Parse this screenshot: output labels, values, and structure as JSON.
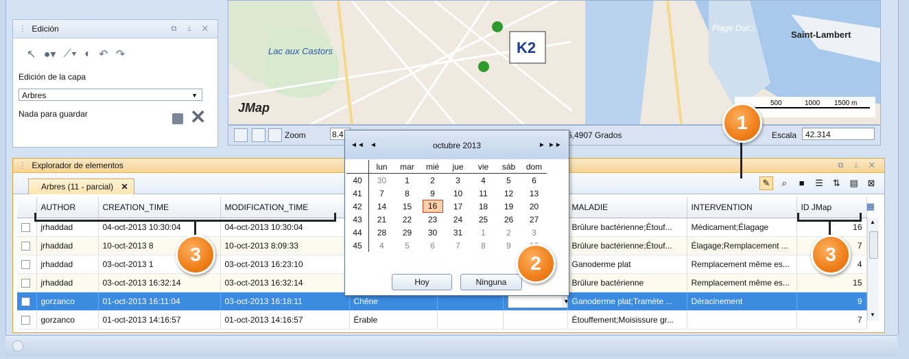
{
  "edition": {
    "title": "Edición",
    "layer_label": "Edición de la capa",
    "layer_value": "Arbres",
    "status": "Nada para guardar"
  },
  "map": {
    "labels": {
      "castors": "Lac aux Castors",
      "plage": "Plage Dor□",
      "lambert": "Saint-Lambert",
      "brand": "JMap",
      "logo": "K2"
    },
    "scalebar": [
      "500",
      "1000",
      "1500 m"
    ],
    "zoom_label": "Zoom",
    "zoom_value": "8.4",
    "coord_value": "5,4907 Grados",
    "scale_label": "Escala",
    "scale_value": "42.314"
  },
  "explorer": {
    "title": "Explorador de elementos",
    "tab_label": "Arbres (11 - parcial)",
    "tab_close": "✕",
    "columns": [
      "AUTHOR",
      "CREATION_TIME",
      "MODIFICATION_TIME",
      "",
      "",
      "",
      "MALADIE",
      "INTERVENTION",
      "ID JMap"
    ],
    "rows": [
      {
        "author": "jrhaddad",
        "created": "04-oct-2013 10:30:04",
        "modified": "04-oct-2013 10:30:04",
        "c4": "",
        "c5": "",
        "c6": "",
        "maladie": "Brûlure bactérienne;Étouf...",
        "intervention": "Médicament;Élagage",
        "id": "16"
      },
      {
        "author": "jrhaddad",
        "created": "10-oct-2013 8",
        "modified": "10-oct-2013 8:09:33",
        "c4": "",
        "c5": "",
        "c6": "",
        "maladie": "Brûlure bactérienne;Étouf...",
        "intervention": "Élagage;Remplacement ...",
        "id": "7"
      },
      {
        "author": "jrhaddad",
        "created": "03-oct-2013 1",
        "modified": "03-oct-2013 16:23:10",
        "c4": "",
        "c5": "",
        "c6": "",
        "maladie": "Ganoderme plat",
        "intervention": "Remplacement même es...",
        "id": "4"
      },
      {
        "author": "jrhaddad",
        "created": "03-oct-2013 16:32:14",
        "modified": "03-oct-2013 16:32:14",
        "c4": "",
        "c5": "",
        "c6": "",
        "maladie": "Brûlure bactérienne",
        "intervention": "Remplacement même es...",
        "id": "15"
      },
      {
        "author": "gorzanco",
        "created": "01-oct-2013 16:11:04",
        "modified": "03-oct-2013 16:18:11",
        "c4": "Chêne",
        "c5": "",
        "c6": "",
        "maladie": "Ganoderme plat;Tramète ...",
        "intervention": "Déracinement",
        "id": "9"
      },
      {
        "author": "gorzanco",
        "created": "01-oct-2013 14:16:57",
        "modified": "01-oct-2013 14:16:57",
        "c4": "Érable",
        "c5": "",
        "c6": "",
        "maladie": "Étouffement;Moisissure gr...",
        "intervention": "",
        "id": "7"
      }
    ]
  },
  "calendar": {
    "title": "octubre 2013",
    "nav_prev_year": "◄◄",
    "nav_prev": "◄",
    "nav_next": "►",
    "nav_next_year": "►►",
    "weekdays": [
      "lun",
      "mar",
      "mié",
      "jue",
      "vie",
      "sáb",
      "dom"
    ],
    "weeks": [
      {
        "wk": "40",
        "days": [
          "30",
          "1",
          "2",
          "3",
          "4",
          "5",
          "6"
        ]
      },
      {
        "wk": "41",
        "days": [
          "7",
          "8",
          "9",
          "10",
          "11",
          "12",
          "13"
        ]
      },
      {
        "wk": "42",
        "days": [
          "14",
          "15",
          "16",
          "17",
          "18",
          "19",
          "20"
        ]
      },
      {
        "wk": "43",
        "days": [
          "21",
          "22",
          "23",
          "24",
          "25",
          "26",
          "27"
        ]
      },
      {
        "wk": "44",
        "days": [
          "28",
          "29",
          "30",
          "31",
          "1",
          "2",
          "3"
        ]
      },
      {
        "wk": "45",
        "days": [
          "4",
          "5",
          "6",
          "7",
          "8",
          "9",
          "10"
        ]
      }
    ],
    "today_btn": "Hoy",
    "none_btn": "Ninguna"
  },
  "callouts": [
    "1",
    "2",
    "3",
    "3"
  ],
  "colors": {
    "accent": "#ef7f1a",
    "selection": "#3b8be0",
    "panel_header": "#f6d594"
  }
}
